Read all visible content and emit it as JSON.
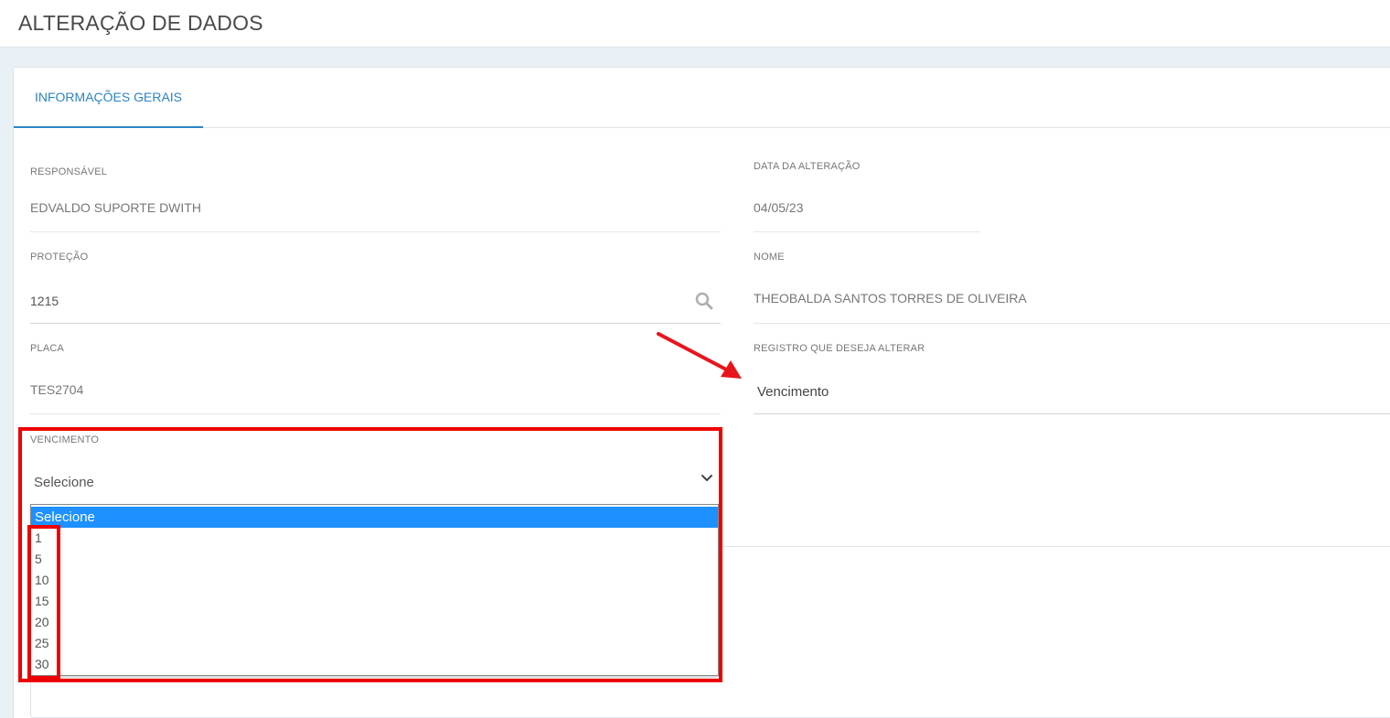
{
  "header": {
    "title": "ALTERAÇÃO DE DADOS"
  },
  "tabs": [
    {
      "label": "INFORMAÇÕES GERAIS",
      "active": true
    }
  ],
  "form": {
    "responsavel": {
      "label": "RESPONSÁVEL",
      "value": "EDVALDO SUPORTE DWITH"
    },
    "data_alteracao": {
      "label": "DATA DA ALTERAÇÃO",
      "value": "04/05/23"
    },
    "protecao": {
      "label": "PROTEÇÃO",
      "value": "1215"
    },
    "nome": {
      "label": "NOME",
      "value": "THEOBALDA SANTOS TORRES DE OLIVEIRA"
    },
    "placa": {
      "label": "PLACA",
      "value": "TES2704"
    },
    "registro": {
      "label": "REGISTRO QUE DESEJA ALTERAR",
      "value": "Vencimento"
    },
    "vencimento": {
      "label": "VENCIMENTO",
      "selected": "Selecione",
      "options": [
        "Selecione",
        "1",
        "5",
        "10",
        "15",
        "20",
        "25",
        "30"
      ]
    }
  },
  "colors": {
    "accent": "#2b84c6",
    "highlight": "#ee0000",
    "selected_option": "#1e90ff"
  },
  "icons": {
    "search": "search-icon",
    "chevron": "chevron-down-icon",
    "annotation_arrow": "arrow-icon"
  }
}
